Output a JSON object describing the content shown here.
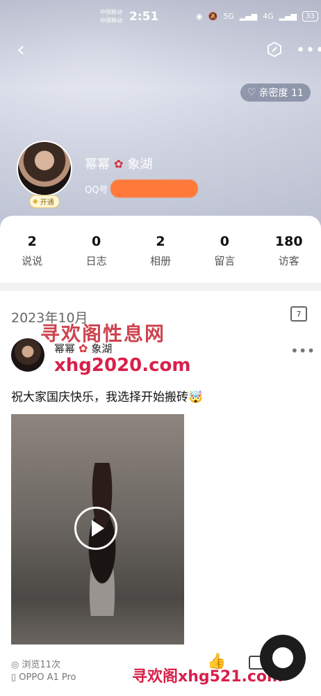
{
  "status_bar": {
    "carrier_line1": "中国移动",
    "carrier_line2": "中国移动",
    "time": "2:51",
    "signal_text": "5G",
    "signal_text2": "4G",
    "battery": "33"
  },
  "header": {
    "back_icon": "chevron-left-icon",
    "intimacy_label": "亲密度 11",
    "profile_name_left": "幂幂",
    "profile_name_right": "象湖",
    "qq_label": "QQ号",
    "vip_label": "开通"
  },
  "stats": [
    {
      "num": "2",
      "label": "说说"
    },
    {
      "num": "0",
      "label": "日志"
    },
    {
      "num": "2",
      "label": "相册"
    },
    {
      "num": "0",
      "label": "留言"
    },
    {
      "num": "180",
      "label": "访客"
    }
  ],
  "feed": {
    "month": "2023年10月",
    "calendar_day": "7",
    "watermark_top": "寻欢阁性息网",
    "watermark_mid": "xhg2020.com",
    "watermark_bottom": "寻欢阁xhg521.com",
    "post": {
      "name_left": "幂幂",
      "name_right": "象湖",
      "text": "祝大家国庆快乐，我选择开始搬砖🤯",
      "views": "浏览11次",
      "device": "OPPO A1 Pro"
    }
  },
  "colors": {
    "accent_red": "#d8204a",
    "redact_orange": "#ff7a3a"
  }
}
